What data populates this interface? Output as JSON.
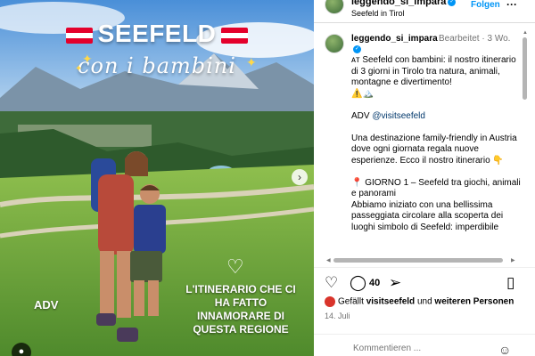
{
  "photo": {
    "title": "SEEFELD",
    "subtitle": "con i bambini",
    "adv_label": "ADV",
    "overlay_caption": "L'ITINERARIO CHE CI HA FATTO INNAMORARE DI QUESTA REGIONE",
    "next_icon": "chevron-right-icon",
    "tag_icon": "person-icon",
    "flag_colors": [
      "#e4002b",
      "#ffffff"
    ]
  },
  "header": {
    "username": "leggendo_si_impara",
    "location": "Seefeld in Tirol",
    "follow_label": "Folgen",
    "more_label": "···"
  },
  "caption": {
    "username": "leggendo_si_impara",
    "edited": "Bearbeitet",
    "separator": "·",
    "age": "3 Wo.",
    "text": "ᴀᴛ Seefeld con bambini: il nostro itinerario di 3 giorni in Tirolo tra natura, animali, montagne e divertimento!\n⚠️🏔️\n\nADV ",
    "mention": "@visitseefeld",
    "text_continued": "\n\nUna destinazione family-friendly in Austria dove ogni giornata regala nuove esperienze. Ecco il nostro itinerario 👇\n\n📍 GIORNO 1 – Seefeld tra giochi, animali e panorami\nAbbiamo iniziato con una bellissima passeggiata circolare alla scoperta dei luoghi simbolo di Seefeld: imperdibile"
  },
  "actions": {
    "like_icon": "heart-icon",
    "comment_icon": "comment-icon",
    "comment_count": "40",
    "share_icon": "share-icon",
    "save_icon": "bookmark-icon"
  },
  "likes": {
    "prefix": "Gefällt ",
    "user": "visitseefeld",
    "middle": " und ",
    "others": "weiteren Personen"
  },
  "date": "14. Juli",
  "comment": {
    "placeholder": "Kommentieren ...",
    "emoji_icon": "smiley-icon"
  },
  "colors": {
    "accent_blue": "#0095f6",
    "mention_blue": "#00376b",
    "muted_gray": "#737373"
  }
}
